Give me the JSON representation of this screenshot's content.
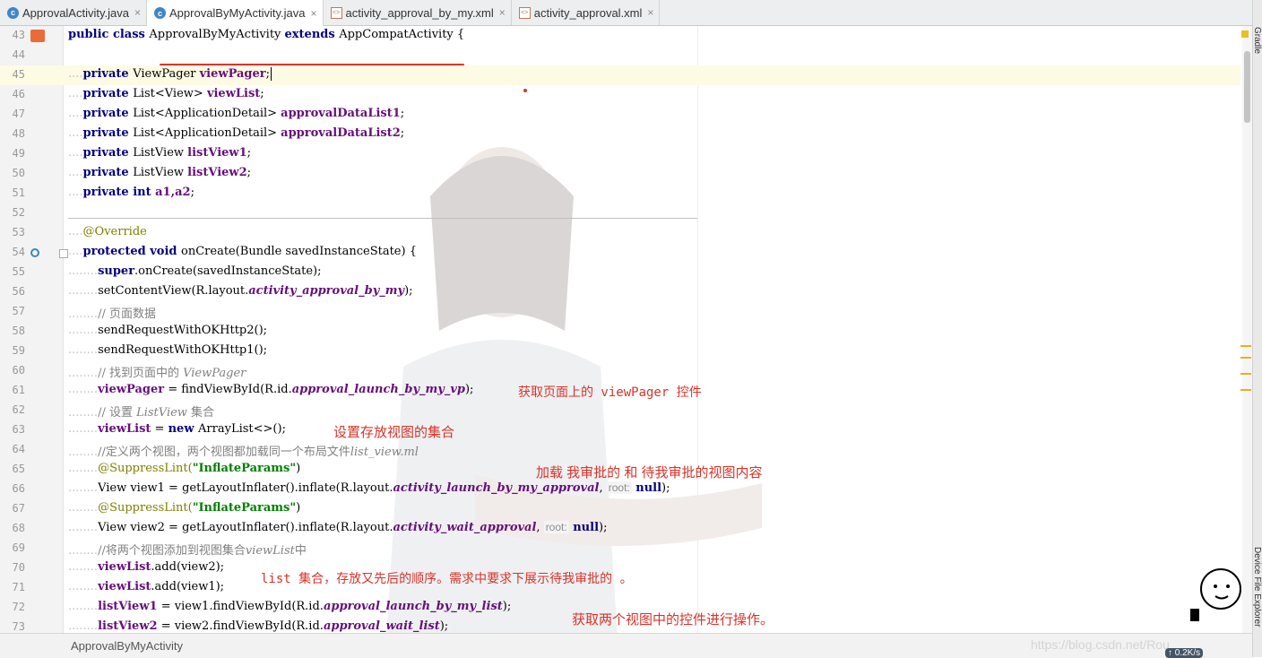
{
  "tabs": [
    {
      "label": "ApprovalActivity.java",
      "icon": "c-class-icon",
      "active": false
    },
    {
      "label": "ApprovalByMyActivity.java",
      "icon": "c-class-icon",
      "active": true
    },
    {
      "label": "activity_approval_by_my.xml",
      "icon": "xml-icon",
      "active": false
    },
    {
      "label": "activity_approval.xml",
      "icon": "xml-icon",
      "active": false
    }
  ],
  "tab_close": "×",
  "side_panels": {
    "gradle": "Gradle",
    "device_file_explorer": "Device File Explorer"
  },
  "line_numbers": [
    "43",
    "44",
    "45",
    "46",
    "47",
    "48",
    "49",
    "50",
    "51",
    "52",
    "53",
    "54",
    "55",
    "56",
    "57",
    "58",
    "59",
    "60",
    "61",
    "62",
    "63",
    "64",
    "65",
    "66",
    "67",
    "68",
    "69",
    "70",
    "71",
    "72",
    "73"
  ],
  "code": {
    "l43": {
      "kw1": "public class ",
      "cls": "ApprovalByMyActivity ",
      "kw2": "extends ",
      "sup": "AppCompatActivity ",
      "end": "{"
    },
    "priv": "private ",
    "l45": {
      "type": "ViewPager ",
      "name": "viewPager",
      "end": ";"
    },
    "l46": {
      "type": "List<View> ",
      "name": "viewList",
      "end": ";"
    },
    "l47": {
      "type": "List<ApplicationDetail> ",
      "name": "approvalDataList1",
      "end": ";"
    },
    "l48": {
      "type": "List<ApplicationDetail> ",
      "name": "approvalDataList2",
      "end": ";"
    },
    "l49": {
      "type": "ListView ",
      "name": "listView1",
      "end": ";"
    },
    "l50": {
      "type": "ListView ",
      "name": "listView2",
      "end": ";"
    },
    "l51": {
      "kw": "int ",
      "name": "a1,a2",
      "end": ";"
    },
    "l53": "@Override",
    "l54": {
      "kw": "protected void ",
      "rest": "onCreate(Bundle savedInstanceState) {"
    },
    "l55": {
      "kw": "super",
      "rest": ".onCreate(savedInstanceState);"
    },
    "l56": {
      "a": "setContentView(R.layout.",
      "res": "activity_approval_by_my",
      "b": ");"
    },
    "l57": "// 页面数据",
    "l58": "sendRequestWithOKHttp2();",
    "l59": "sendRequestWithOKHttp1();",
    "l60": {
      "a": "// 找到页面中的 ",
      "b": "ViewPager"
    },
    "l61": {
      "fld": "viewPager",
      "a": " = findViewById(R.id.",
      "res": "approval_launch_by_my_vp",
      "b": ");"
    },
    "l62": {
      "a": "// 设置 ",
      "b": "ListView",
      "c": " 集合"
    },
    "l63": {
      "fld": "viewList",
      "a": " = ",
      "kw": "new ",
      "b": "ArrayList<>();"
    },
    "l64": {
      "a": "//定义两个视图，两个视图都加载同一个布局文件",
      "b": "list_view.ml"
    },
    "l65": {
      "ann": "@SuppressLint(",
      "str": "\"InflateParams\"",
      "end": ")"
    },
    "l66": {
      "a": "View view1 = getLayoutInflater().inflate(R.layout.",
      "res": "activity_launch_by_my_approval",
      "b": ", ",
      "hint": "root:",
      "kw": " null",
      "c": ");"
    },
    "l67": {
      "ann": "@SuppressLint(",
      "str": "\"InflateParams\"",
      "end": ")"
    },
    "l68": {
      "a": "View view2 = getLayoutInflater().inflate(R.layout.",
      "res": "activity_wait_approval",
      "b": ", ",
      "hint": "root:",
      "kw": " null",
      "c": ");"
    },
    "l69": {
      "a": "//将两个视图添加到视图集合",
      "b": "viewList",
      "c": "中"
    },
    "l70": {
      "fld": "viewList",
      "a": ".add(view2);"
    },
    "l71": {
      "fld": "viewList",
      "a": ".add(view1);"
    },
    "l72": {
      "fld": "listView1",
      "a": " = view1.findViewById(R.id.",
      "res": "approval_launch_by_my_list",
      "b": ");"
    },
    "l73": {
      "fld": "listView2",
      "a": " = view2.findViewById(R.id.",
      "res": "approval_wait_list",
      "b": ");"
    }
  },
  "notes": {
    "n1": "获取页面上的 viewPager 控件",
    "n2": "设置存放视图的集合",
    "n3": "加载 我审批的 和 待我审批的视图内容",
    "n4": "list 集合，存放又先后的顺序。需求中要求下展示待我审批的 。",
    "n5": "获取两个视图中的控件进行操作。"
  },
  "status_bar": {
    "breadcrumb": "ApprovalByMyActivity",
    "watermark": "https://blog.csdn.net/Rou",
    "net_speed": "↑ 0.2K/s"
  },
  "colors": {
    "keyword": "#000080",
    "field": "#660e7a",
    "comment": "#808080",
    "annotation": "#808000",
    "string": "#008000",
    "note": "#d8332a"
  }
}
